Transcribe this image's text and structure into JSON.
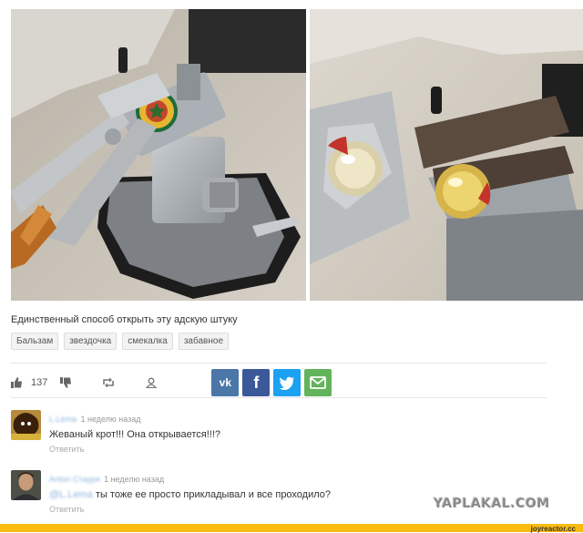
{
  "post": {
    "caption": "Единственный способ открыть эту адскую штуку",
    "tags": [
      "Бальзам",
      "звездочка",
      "смекалка",
      "забавное"
    ],
    "rating": "137"
  },
  "icons": {
    "like": "thumb-up-icon",
    "dislike": "thumb-down-icon",
    "repost": "repost-icon",
    "share": "share-user-icon"
  },
  "share_buttons": [
    {
      "label": "vk",
      "color": "#4a76a8"
    },
    {
      "label": "f",
      "color": "#3b5998"
    },
    {
      "label": "t",
      "color": "#1da1f2"
    },
    {
      "label": "✉",
      "color": "#62b35a"
    }
  ],
  "comments": [
    {
      "author": "L.Lema",
      "time": "1 неделю назад",
      "text": "Жеваный крот!!! Она открывается!!!?",
      "reply": "Ответить"
    },
    {
      "author": "Anton Стауря",
      "time": "1 неделю назад",
      "mention": "@L.Lema",
      "text": "ты тоже ее просто прикладывал и все проходило?",
      "reply": "Ответить"
    }
  ],
  "watermark": "YAPLAKAL.COM",
  "footer": {
    "label": "joyreactor.cc",
    "color": "#fbbc12"
  }
}
